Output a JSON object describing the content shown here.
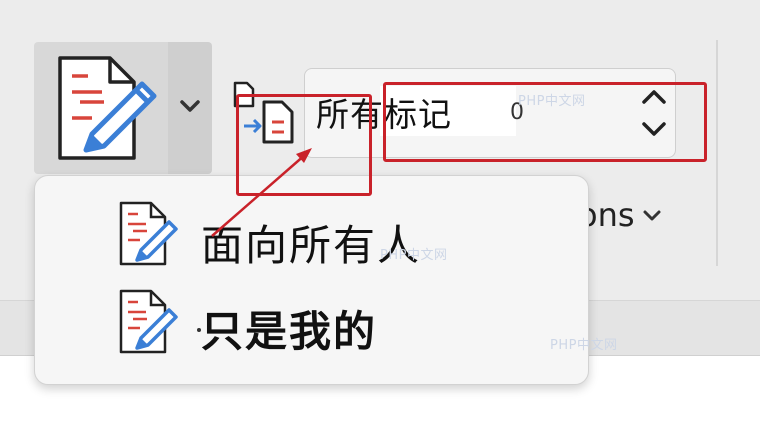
{
  "markup": {
    "selected_value": "所有标记",
    "tail_glyph": "0",
    "partial_label": "ons"
  },
  "menu": {
    "items": [
      {
        "label": "面向所有人"
      },
      {
        "label": "只是我的"
      }
    ]
  },
  "watermarks": {
    "text1": "PHP中文网",
    "text2": "PHP中文网",
    "text3": "PHP中文网"
  },
  "colors": {
    "annotation": "#c9222a",
    "icon_blue": "#3b7fd6",
    "icon_red": "#d8453b"
  },
  "icons": {
    "track_changes": "track-changes-pen-icon",
    "compare": "compare-document-icon",
    "chevron": "chevron-down-icon",
    "stepper": "up-down-stepper-icon"
  }
}
